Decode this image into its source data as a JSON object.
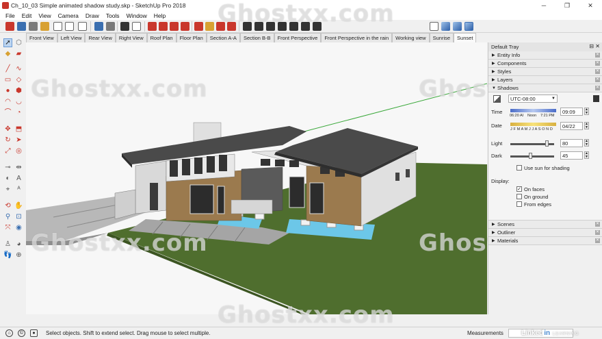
{
  "window": {
    "title": "Ch_10_03  Simple animated shadow study.skp - SketchUp Pro 2018",
    "controls": [
      "─",
      "❐",
      "✕"
    ]
  },
  "menu": [
    "File",
    "Edit",
    "View",
    "Camera",
    "Draw",
    "Tools",
    "Window",
    "Help"
  ],
  "scenes": [
    "Front View",
    "Left View",
    "Rear View",
    "Right View",
    "Roof Plan",
    "Floor Plan",
    "Section A-A",
    "Section B-B",
    "Front Perspective",
    "Front Perspective in the rain",
    "Working view",
    "Sunrise",
    "Sunset"
  ],
  "active_scene": "Sunset",
  "tray": {
    "title": "Default Tray",
    "panels_top": [
      "Entity Info",
      "Components",
      "Styles",
      "Layers"
    ],
    "shadows": {
      "title": "Shadows",
      "timezone": "UTC-08:00",
      "time_label": "Time",
      "time_start": "06:20 AI",
      "time_noon": "Noon",
      "time_end": "7:21 PM",
      "time_value": "09:09",
      "date_label": "Date",
      "months": "J F M A M J J A S O N D",
      "date_value": "04/22",
      "light_label": "Light",
      "light_value": "80",
      "light_level": 0.8,
      "dark_label": "Dark",
      "dark_value": "45",
      "dark_level": 0.45,
      "use_sun_label": "Use sun for shading",
      "display_label": "Display:",
      "on_faces": "On faces",
      "on_ground": "On ground",
      "from_edges": "From edges",
      "on_faces_checked": true,
      "on_ground_checked": false,
      "from_edges_checked": false,
      "use_sun_checked": false
    },
    "panels_bottom": [
      "Scenes",
      "Outliner",
      "Materials"
    ]
  },
  "status": {
    "hint": "Select objects. Shift to extend select. Drag mouse to select multiple.",
    "measurements_label": "Measurements",
    "measurements_value": "",
    "brand": "Linked",
    "brand_in": "in",
    "brand_sub": "LEARNING"
  },
  "watermark": "Ghostxx.com",
  "icons": {
    "toolbar": [
      "select-icon",
      "eraser-icon",
      "paint-icon",
      "undo-icon",
      "redo-icon",
      "print-icon",
      "model-info-icon",
      "warehouse-icon",
      "extension-icon",
      "home-icon",
      "standard-views-icon"
    ],
    "views": [
      "orbit-icon",
      "pan-icon",
      "zoom-icon",
      "iso-view-icon"
    ]
  },
  "colors": {
    "ground": "#4a6b2b",
    "roof": "#4a4a4a",
    "wood": "#9b7a4e",
    "water": "#6cc7e8",
    "wall": "#e3e3e3"
  }
}
